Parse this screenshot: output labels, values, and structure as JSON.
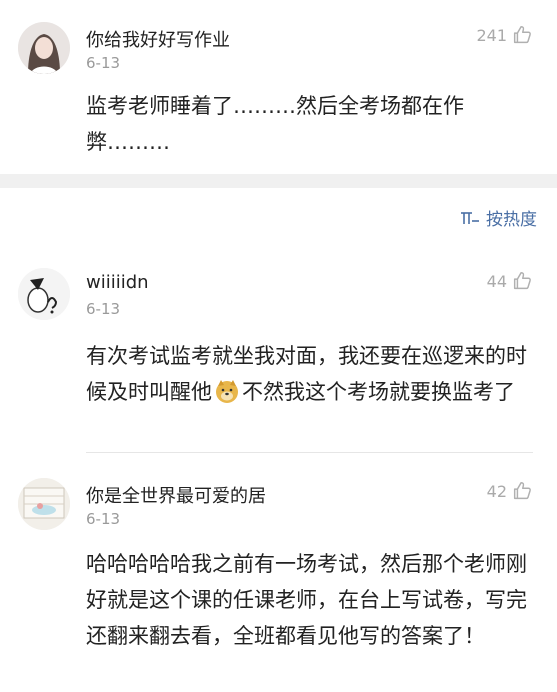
{
  "comments": [
    {
      "username": "你给我好好写作业",
      "date": "6-13",
      "likes": "241",
      "text": "监考老师睡着了………然后全考场都在作弊………"
    },
    {
      "username": "wiiiiidn",
      "date": "6-13",
      "likes": "44",
      "text_before_emoji": "有次考试监考就坐我对面，我还要在巡逻来的时候及时叫醒他",
      "emoji": "doge-emoji",
      "text_after_emoji": "不然我这个考场就要换监考了"
    },
    {
      "username": "你是全世界最可爱的居",
      "date": "6-13",
      "likes": "42",
      "text": "哈哈哈哈哈我之前有一场考试，然后那个老师刚好就是这个课的任课老师，在台上写试卷，写完还翻来翻去看，全班都看见他写的答案了！"
    }
  ],
  "sort": {
    "label": "按热度",
    "icon": "sort-icon"
  },
  "colors": {
    "accent": "#4a6fa5",
    "muted": "#9a9a9a",
    "divider": "#f0f0f0"
  }
}
